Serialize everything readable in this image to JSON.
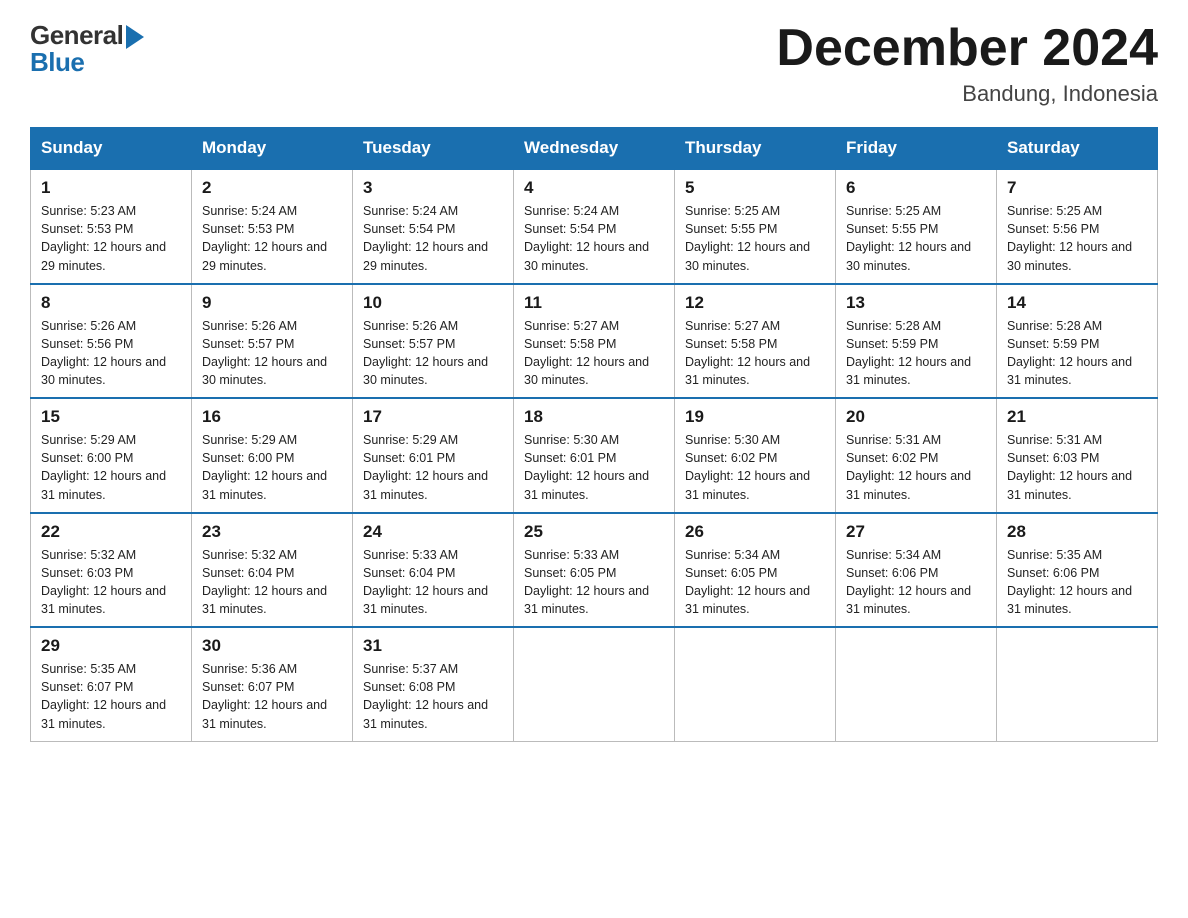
{
  "header": {
    "logo_general": "General",
    "logo_blue": "Blue",
    "title": "December 2024",
    "location": "Bandung, Indonesia"
  },
  "calendar": {
    "days_of_week": [
      "Sunday",
      "Monday",
      "Tuesday",
      "Wednesday",
      "Thursday",
      "Friday",
      "Saturday"
    ],
    "weeks": [
      [
        {
          "day": "1",
          "sunrise": "5:23 AM",
          "sunset": "5:53 PM",
          "daylight": "12 hours and 29 minutes."
        },
        {
          "day": "2",
          "sunrise": "5:24 AM",
          "sunset": "5:53 PM",
          "daylight": "12 hours and 29 minutes."
        },
        {
          "day": "3",
          "sunrise": "5:24 AM",
          "sunset": "5:54 PM",
          "daylight": "12 hours and 29 minutes."
        },
        {
          "day": "4",
          "sunrise": "5:24 AM",
          "sunset": "5:54 PM",
          "daylight": "12 hours and 30 minutes."
        },
        {
          "day": "5",
          "sunrise": "5:25 AM",
          "sunset": "5:55 PM",
          "daylight": "12 hours and 30 minutes."
        },
        {
          "day": "6",
          "sunrise": "5:25 AM",
          "sunset": "5:55 PM",
          "daylight": "12 hours and 30 minutes."
        },
        {
          "day": "7",
          "sunrise": "5:25 AM",
          "sunset": "5:56 PM",
          "daylight": "12 hours and 30 minutes."
        }
      ],
      [
        {
          "day": "8",
          "sunrise": "5:26 AM",
          "sunset": "5:56 PM",
          "daylight": "12 hours and 30 minutes."
        },
        {
          "day": "9",
          "sunrise": "5:26 AM",
          "sunset": "5:57 PM",
          "daylight": "12 hours and 30 minutes."
        },
        {
          "day": "10",
          "sunrise": "5:26 AM",
          "sunset": "5:57 PM",
          "daylight": "12 hours and 30 minutes."
        },
        {
          "day": "11",
          "sunrise": "5:27 AM",
          "sunset": "5:58 PM",
          "daylight": "12 hours and 30 minutes."
        },
        {
          "day": "12",
          "sunrise": "5:27 AM",
          "sunset": "5:58 PM",
          "daylight": "12 hours and 31 minutes."
        },
        {
          "day": "13",
          "sunrise": "5:28 AM",
          "sunset": "5:59 PM",
          "daylight": "12 hours and 31 minutes."
        },
        {
          "day": "14",
          "sunrise": "5:28 AM",
          "sunset": "5:59 PM",
          "daylight": "12 hours and 31 minutes."
        }
      ],
      [
        {
          "day": "15",
          "sunrise": "5:29 AM",
          "sunset": "6:00 PM",
          "daylight": "12 hours and 31 minutes."
        },
        {
          "day": "16",
          "sunrise": "5:29 AM",
          "sunset": "6:00 PM",
          "daylight": "12 hours and 31 minutes."
        },
        {
          "day": "17",
          "sunrise": "5:29 AM",
          "sunset": "6:01 PM",
          "daylight": "12 hours and 31 minutes."
        },
        {
          "day": "18",
          "sunrise": "5:30 AM",
          "sunset": "6:01 PM",
          "daylight": "12 hours and 31 minutes."
        },
        {
          "day": "19",
          "sunrise": "5:30 AM",
          "sunset": "6:02 PM",
          "daylight": "12 hours and 31 minutes."
        },
        {
          "day": "20",
          "sunrise": "5:31 AM",
          "sunset": "6:02 PM",
          "daylight": "12 hours and 31 minutes."
        },
        {
          "day": "21",
          "sunrise": "5:31 AM",
          "sunset": "6:03 PM",
          "daylight": "12 hours and 31 minutes."
        }
      ],
      [
        {
          "day": "22",
          "sunrise": "5:32 AM",
          "sunset": "6:03 PM",
          "daylight": "12 hours and 31 minutes."
        },
        {
          "day": "23",
          "sunrise": "5:32 AM",
          "sunset": "6:04 PM",
          "daylight": "12 hours and 31 minutes."
        },
        {
          "day": "24",
          "sunrise": "5:33 AM",
          "sunset": "6:04 PM",
          "daylight": "12 hours and 31 minutes."
        },
        {
          "day": "25",
          "sunrise": "5:33 AM",
          "sunset": "6:05 PM",
          "daylight": "12 hours and 31 minutes."
        },
        {
          "day": "26",
          "sunrise": "5:34 AM",
          "sunset": "6:05 PM",
          "daylight": "12 hours and 31 minutes."
        },
        {
          "day": "27",
          "sunrise": "5:34 AM",
          "sunset": "6:06 PM",
          "daylight": "12 hours and 31 minutes."
        },
        {
          "day": "28",
          "sunrise": "5:35 AM",
          "sunset": "6:06 PM",
          "daylight": "12 hours and 31 minutes."
        }
      ],
      [
        {
          "day": "29",
          "sunrise": "5:35 AM",
          "sunset": "6:07 PM",
          "daylight": "12 hours and 31 minutes."
        },
        {
          "day": "30",
          "sunrise": "5:36 AM",
          "sunset": "6:07 PM",
          "daylight": "12 hours and 31 minutes."
        },
        {
          "day": "31",
          "sunrise": "5:37 AM",
          "sunset": "6:08 PM",
          "daylight": "12 hours and 31 minutes."
        },
        null,
        null,
        null,
        null
      ]
    ]
  }
}
